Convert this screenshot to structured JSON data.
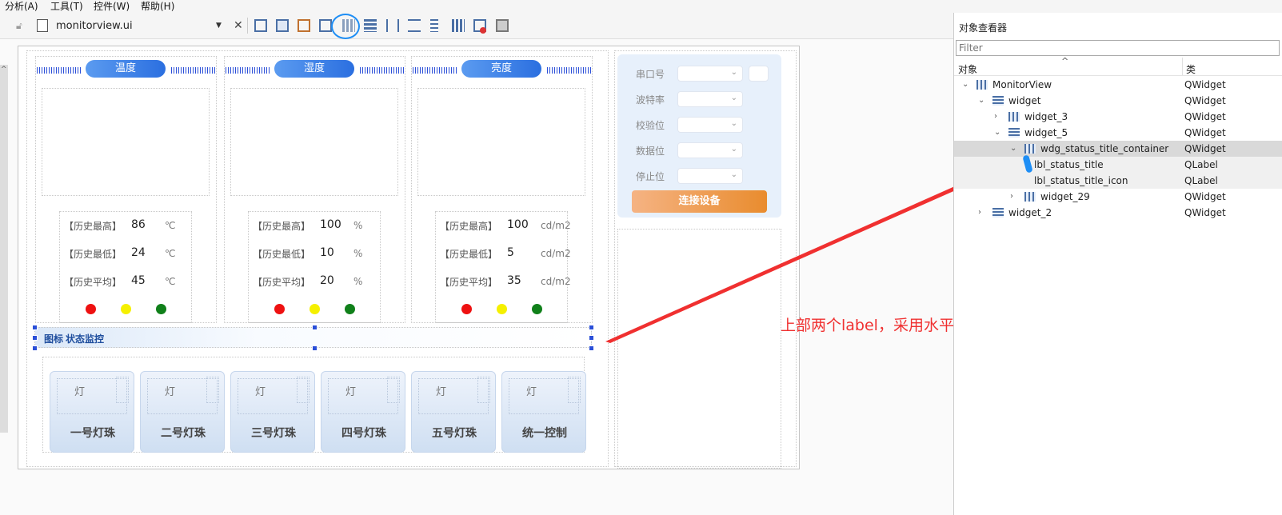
{
  "menu": [
    "分析(A)",
    "工具(T)",
    "控件(W)",
    "帮助(H)"
  ],
  "toolbar": {
    "file_name": "monitorview.ui",
    "close": "✕"
  },
  "sensors": [
    {
      "title": "温度",
      "rows": [
        {
          "label": "【历史最高】",
          "value": "86",
          "unit": "℃"
        },
        {
          "label": "【历史最低】",
          "value": "24",
          "unit": "℃"
        },
        {
          "label": "【历史平均】",
          "value": "45",
          "unit": "℃"
        }
      ]
    },
    {
      "title": "湿度",
      "rows": [
        {
          "label": "【历史最高】",
          "value": "100",
          "unit": "%"
        },
        {
          "label": "【历史最低】",
          "value": "10",
          "unit": "%"
        },
        {
          "label": "【历史平均】",
          "value": "20",
          "unit": "%"
        }
      ]
    },
    {
      "title": "亮度",
      "rows": [
        {
          "label": "【历史最高】",
          "value": "100",
          "unit": "cd/m2"
        },
        {
          "label": "【历史最低】",
          "value": "5",
          "unit": "cd/m2"
        },
        {
          "label": "【历史平均】",
          "value": "35",
          "unit": "cd/m2"
        }
      ]
    }
  ],
  "status_colors": {
    "red": "#ee1111",
    "yellow": "#f5f000",
    "green": "#10801a"
  },
  "status_bar": {
    "icon_text": "图标",
    "title": "状态监控"
  },
  "lamp_label": "灯",
  "lamps": [
    "一号灯珠",
    "二号灯珠",
    "三号灯珠",
    "四号灯珠",
    "五号灯珠",
    "统一控制"
  ],
  "serial_form": {
    "fields": [
      "串口号",
      "波特率",
      "校验位",
      "数据位",
      "停止位"
    ],
    "connect_button": "连接设备"
  },
  "annotation": "上部两个label，采用水平布局",
  "inspector": {
    "title": "对象查看器",
    "filter_placeholder": "Filter",
    "col_object": "对象",
    "col_class": "类",
    "rows": [
      {
        "name": "MonitorView",
        "cls": "QWidget"
      },
      {
        "name": "widget",
        "cls": "QWidget"
      },
      {
        "name": "widget_3",
        "cls": "QWidget"
      },
      {
        "name": "widget_5",
        "cls": "QWidget"
      },
      {
        "name": "wdg_status_title_container",
        "cls": "QWidget"
      },
      {
        "name": "lbl_status_title",
        "cls": "QLabel"
      },
      {
        "name": "lbl_status_title_icon",
        "cls": "QLabel"
      },
      {
        "name": "widget_29",
        "cls": "QWidget"
      },
      {
        "name": "widget_2",
        "cls": "QWidget"
      }
    ]
  },
  "accent_color": "#2b6fe0",
  "arrow_color": "#f03030"
}
